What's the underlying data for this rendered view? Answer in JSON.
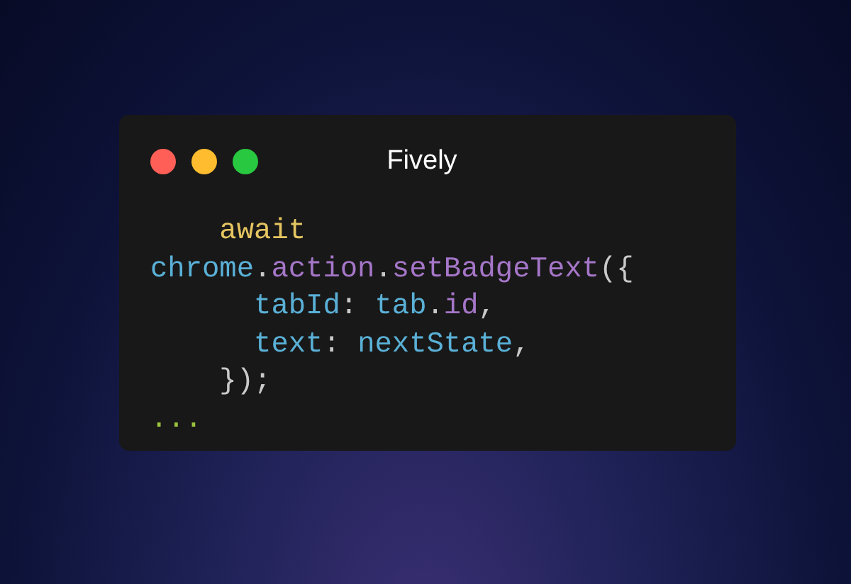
{
  "window": {
    "title": "Fively",
    "controls": [
      {
        "color": "#ff5f57"
      },
      {
        "color": "#febc2e"
      },
      {
        "color": "#28c840"
      }
    ]
  },
  "code": {
    "lines": [
      {
        "tokens": [
          {
            "text": "    await",
            "color": "#e5c561"
          }
        ]
      },
      {
        "tokens": [
          {
            "text": "chrome",
            "color": "#5ab0d6"
          },
          {
            "text": ".",
            "color": "#c9c9c9"
          },
          {
            "text": "action",
            "color": "#a576c8"
          },
          {
            "text": ".",
            "color": "#c9c9c9"
          },
          {
            "text": "setBadgeText",
            "color": "#a576c8"
          },
          {
            "text": "({",
            "color": "#c9c9c9"
          }
        ]
      },
      {
        "tokens": [
          {
            "text": "      tabId",
            "color": "#5ab0d6"
          },
          {
            "text": ": ",
            "color": "#c9c9c9"
          },
          {
            "text": "tab",
            "color": "#5ab0d6"
          },
          {
            "text": ".",
            "color": "#c9c9c9"
          },
          {
            "text": "id",
            "color": "#a576c8"
          },
          {
            "text": ",",
            "color": "#c9c9c9"
          }
        ]
      },
      {
        "tokens": [
          {
            "text": "      text",
            "color": "#5ab0d6"
          },
          {
            "text": ": ",
            "color": "#c9c9c9"
          },
          {
            "text": "nextState",
            "color": "#5ab0d6"
          },
          {
            "text": ",",
            "color": "#c9c9c9"
          }
        ]
      },
      {
        "tokens": [
          {
            "text": "    });",
            "color": "#c9c9c9"
          }
        ]
      },
      {
        "tokens": [
          {
            "text": "...",
            "color": "#9bc53d"
          }
        ]
      }
    ]
  }
}
